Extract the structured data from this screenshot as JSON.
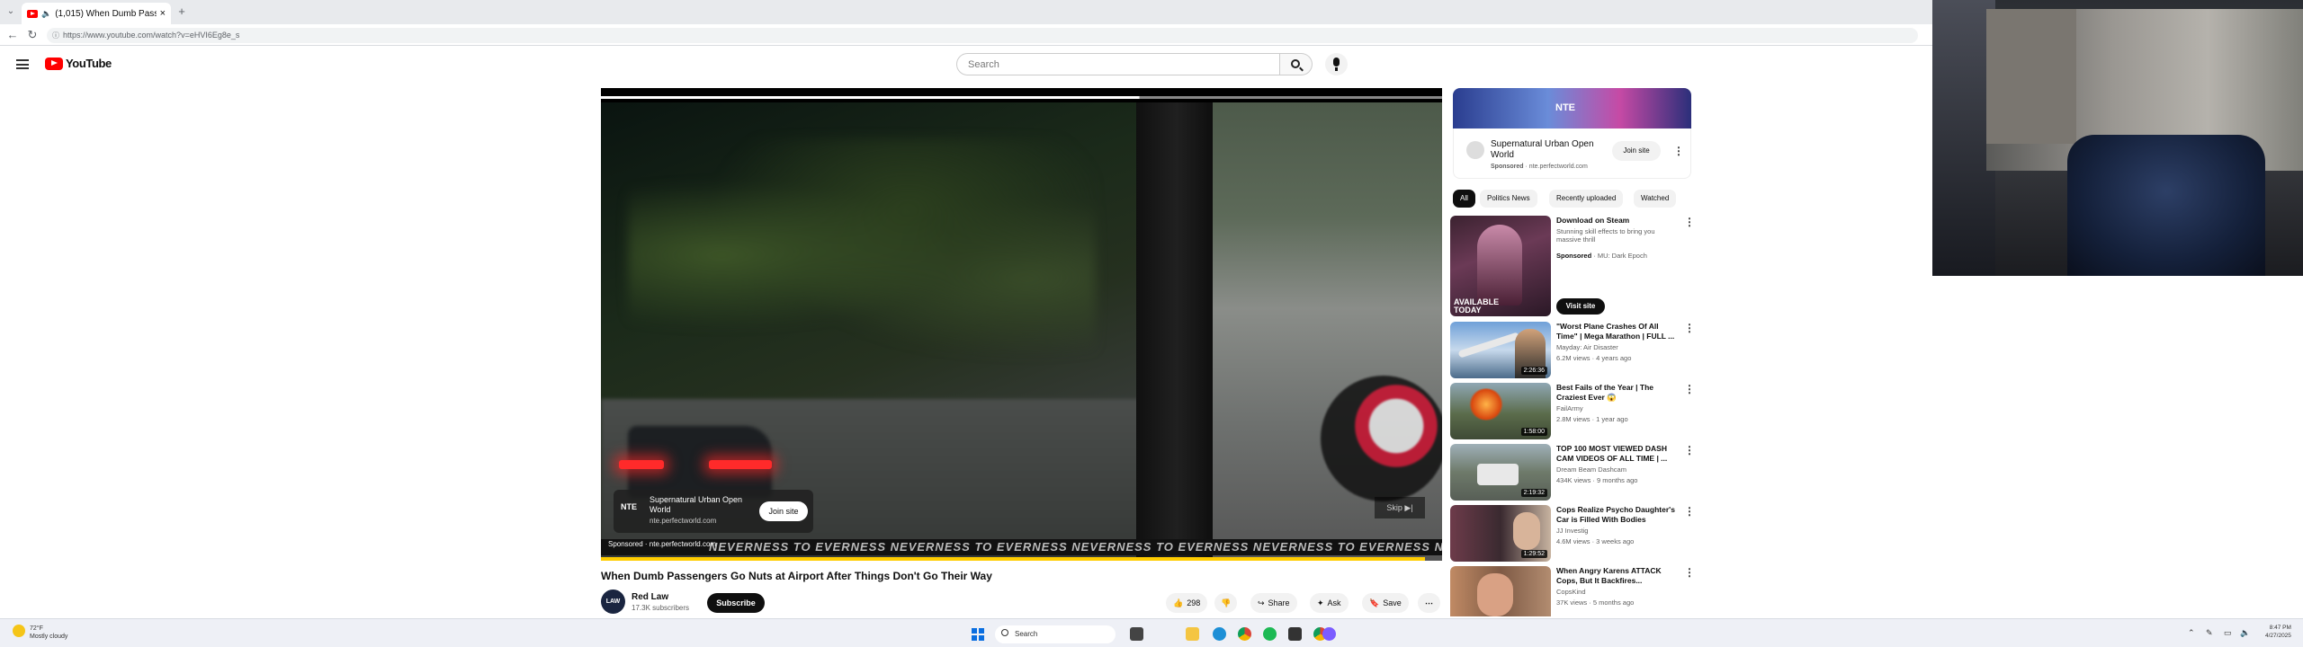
{
  "browser": {
    "tab_title": "(1,015) When Dumb Passeng...",
    "new_tab_symbol": "+",
    "tab_close_symbol": "×",
    "url": "https://www.youtube.com/watch?v=eHVI6Eg8e_s"
  },
  "header": {
    "logo_text": "YouTube",
    "search_placeholder": "Search"
  },
  "player": {
    "ad_title": "Supernatural Urban Open World",
    "ad_logo": "NTE",
    "ad_url": "nte.perfectworld.com",
    "ad_cta": "Join site",
    "skip_label": "Skip ▶|",
    "banner_text": "NEVERNESS TO EVERNESS   NEVERNESS TO EVERNESS   NEVERNESS TO EVERNESS   NEVERNESS TO EVERNESS   NEVERNESS TO EVERNESS",
    "sponsored_label": "Sponsored · nte.perfectworld.com",
    "ad_progress": 0.98
  },
  "video": {
    "title": "When Dumb Passengers Go Nuts at Airport After Things Don't Go Their Way",
    "channel_name": "Red Law",
    "channel_subs": "17.3K subscribers",
    "channel_avatar_text": "LAW",
    "subscribe_label": "Subscribe",
    "like_count": "298",
    "share_label": "Share",
    "ask_label": "Ask",
    "save_label": "Save"
  },
  "sidebar": {
    "ad_banner_text": "NTE",
    "ad": {
      "title": "Supernatural Urban Open World",
      "sponsored": "Sponsored",
      "domain": "nte.perfectworld.com",
      "cta": "Join site"
    },
    "chips": [
      "All",
      "Politics News",
      "Recently uploaded",
      "Watched"
    ],
    "sponsored_rec": {
      "title": "Download on Steam",
      "desc": "Stunning skill effects to bring you massive thrill",
      "sponsored": "Sponsored",
      "advertiser": "MU: Dark Epoch",
      "thumb_text": "AVAILABLE TODAY",
      "cta": "Visit site"
    },
    "recs": [
      {
        "title": "\"Worst Plane Crashes Of All Time\" | Mega Marathon | FULL ...",
        "channel": "Mayday: Air Disaster",
        "meta": "6.2M views · 4 years ago",
        "duration": "2:26:36"
      },
      {
        "title": "Best Fails of the Year | The Craziest Ever 😱",
        "channel": "FailArmy",
        "meta": "2.8M views · 1 year ago",
        "duration": "1:58:00"
      },
      {
        "title": "TOP 100 MOST VIEWED DASH CAM VIDEOS OF ALL TIME | ...",
        "channel": "Dream Beam Dashcam",
        "meta": "434K views · 9 months ago",
        "duration": "2:19:32"
      },
      {
        "title": "Cops Realize Psycho Daughter's Car is Filled With Bodies",
        "channel": "JJ Investig",
        "meta": "4.6M views · 3 weeks ago",
        "duration": "1:29:52"
      },
      {
        "title": "When Angry Karens ATTACK Cops, But It Backfires...",
        "channel": "CopsKind",
        "meta": "37K views · 5 months ago",
        "duration": ""
      }
    ]
  },
  "taskbar": {
    "temp": "72°F",
    "weather": "Mostly cloudy",
    "search_label": "Search",
    "time": "8:47 PM",
    "date": "4/27/2025"
  },
  "colors": {
    "youtube_red": "#ff0000",
    "ad_progress": "#ffcc00",
    "subscribe_bg": "#0f0f0f"
  }
}
